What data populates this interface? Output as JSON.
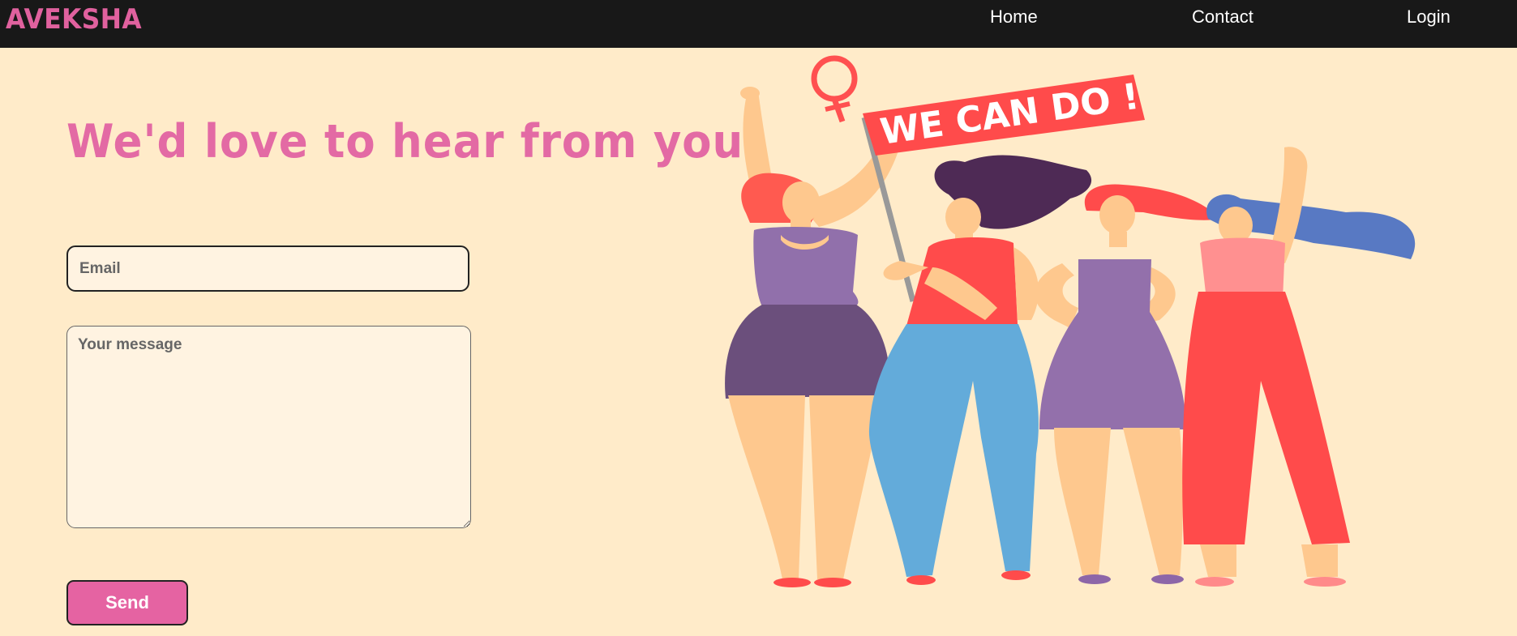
{
  "nav": {
    "brand": "AVEKSHA",
    "links": [
      {
        "label": "Home"
      },
      {
        "label": "Contact"
      },
      {
        "label": "Login"
      }
    ]
  },
  "main": {
    "heading": "We'd love to hear from you.",
    "email": {
      "placeholder": "Email",
      "value": ""
    },
    "message": {
      "placeholder": "Your message",
      "value": ""
    },
    "send_label": "Send"
  },
  "illustration": {
    "icon": "women-empowerment-illustration",
    "banner_text": "WE CAN DO !"
  },
  "colors": {
    "background": "#ffebc9",
    "navbar": "#181818",
    "accent_pink": "#e563a2",
    "field_background": "#fff3e1"
  }
}
